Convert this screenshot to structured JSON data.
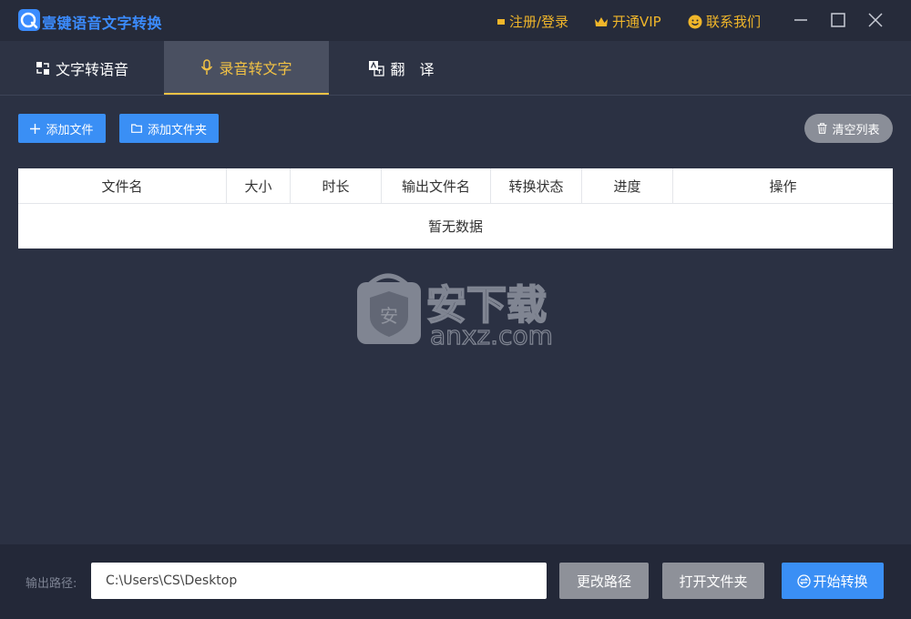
{
  "app": {
    "title": "壹键语音文字转换"
  },
  "titlebar": {
    "register_login": "注册/登录",
    "open_vip": "开通VIP",
    "contact_us": "联系我们"
  },
  "tabs": [
    {
      "label": "文字转语音",
      "active": false
    },
    {
      "label": "录音转文字",
      "active": true
    },
    {
      "label": "翻　译",
      "active": false
    }
  ],
  "toolbar": {
    "add_file": "添加文件",
    "add_folder": "添加文件夹",
    "clear_list": "清空列表"
  },
  "table": {
    "columns": [
      "文件名",
      "大小",
      "时长",
      "输出文件名",
      "转换状态",
      "进度",
      "操作"
    ],
    "rows": [],
    "empty_text": "暂无数据"
  },
  "watermark": {
    "cn": "安下载",
    "en": "anxz.com",
    "badge": "安"
  },
  "footer": {
    "path_label": "输出路径:",
    "path_value": "C:\\Users\\CS\\Desktop",
    "change_path": "更改路径",
    "open_folder": "打开文件夹",
    "start_convert": "开始转换"
  },
  "colors": {
    "accent": "#3a8ff5",
    "active_tab": "#f2c245",
    "link_gold": "#f0b62a",
    "background": "#2b3143"
  }
}
